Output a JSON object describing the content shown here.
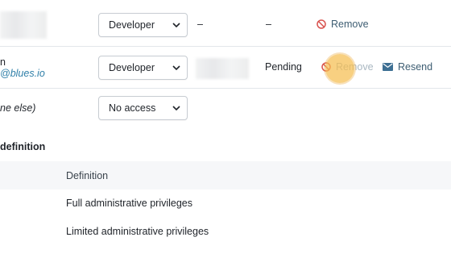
{
  "members": [
    {
      "name": "",
      "email": "",
      "role": "Developer",
      "status_a": "–",
      "status_b": "–",
      "remove_label": "Remove"
    },
    {
      "name": "n",
      "email": "@blues.io",
      "role": "Developer",
      "status": "Pending",
      "remove_label": "Remove",
      "resend_label": "Resend"
    },
    {
      "name": "ne else)",
      "role": "No access"
    }
  ],
  "roles_section": {
    "title": "definition",
    "column_header": "Definition",
    "rows": [
      {
        "definition": "Full administrative privileges"
      },
      {
        "definition": "Limited administrative privileges"
      }
    ]
  },
  "icons": {
    "remove": "prohibit-icon",
    "resend": "envelope-icon",
    "select": "chevron-down-icon"
  },
  "colors": {
    "link": "#3d5d72",
    "email": "#2f7fa8",
    "cursor": "#f5be50"
  }
}
